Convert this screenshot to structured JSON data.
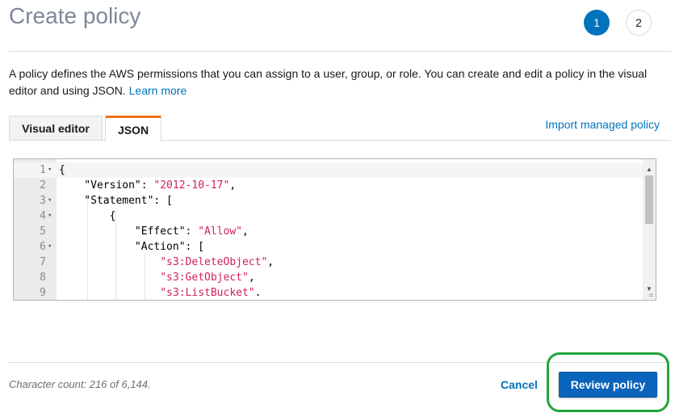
{
  "header": {
    "title": "Create policy",
    "steps": [
      "1",
      "2"
    ]
  },
  "description": {
    "text": "A policy defines the AWS permissions that you can assign to a user, group, or role. You can create and edit a policy in the visual editor and using JSON.",
    "learn_more": "Learn more"
  },
  "tabs": {
    "visual_editor": "Visual editor",
    "json": "JSON",
    "import_link": "Import managed policy"
  },
  "editor": {
    "lines": [
      {
        "num": "1",
        "fold": "▾",
        "text": "{",
        "string": "",
        "after": ""
      },
      {
        "num": "2",
        "fold": "",
        "text": "    \"Version\": ",
        "string": "\"2012-10-17\"",
        "after": ","
      },
      {
        "num": "3",
        "fold": "▾",
        "text": "    \"Statement\": [",
        "string": "",
        "after": ""
      },
      {
        "num": "4",
        "fold": "▾",
        "text": "        {",
        "string": "",
        "after": ""
      },
      {
        "num": "5",
        "fold": "",
        "text": "            \"Effect\": ",
        "string": "\"Allow\"",
        "after": ","
      },
      {
        "num": "6",
        "fold": "▾",
        "text": "            \"Action\": [",
        "string": "",
        "after": ""
      },
      {
        "num": "7",
        "fold": "",
        "text": "                ",
        "string": "\"s3:DeleteObject\"",
        "after": ","
      },
      {
        "num": "8",
        "fold": "",
        "text": "                ",
        "string": "\"s3:GetObject\"",
        "after": ","
      },
      {
        "num": "9",
        "fold": "",
        "text": "                ",
        "string": "\"s3:ListBucket\"",
        "after": "."
      }
    ]
  },
  "footer": {
    "char_count": "Character count: 216 of 6,144.",
    "cancel_label": "Cancel",
    "review_label": "Review policy"
  },
  "colors": {
    "primary": "#0073bb",
    "tab_accent": "#ec7211",
    "highlight_ring": "#22a33a"
  }
}
